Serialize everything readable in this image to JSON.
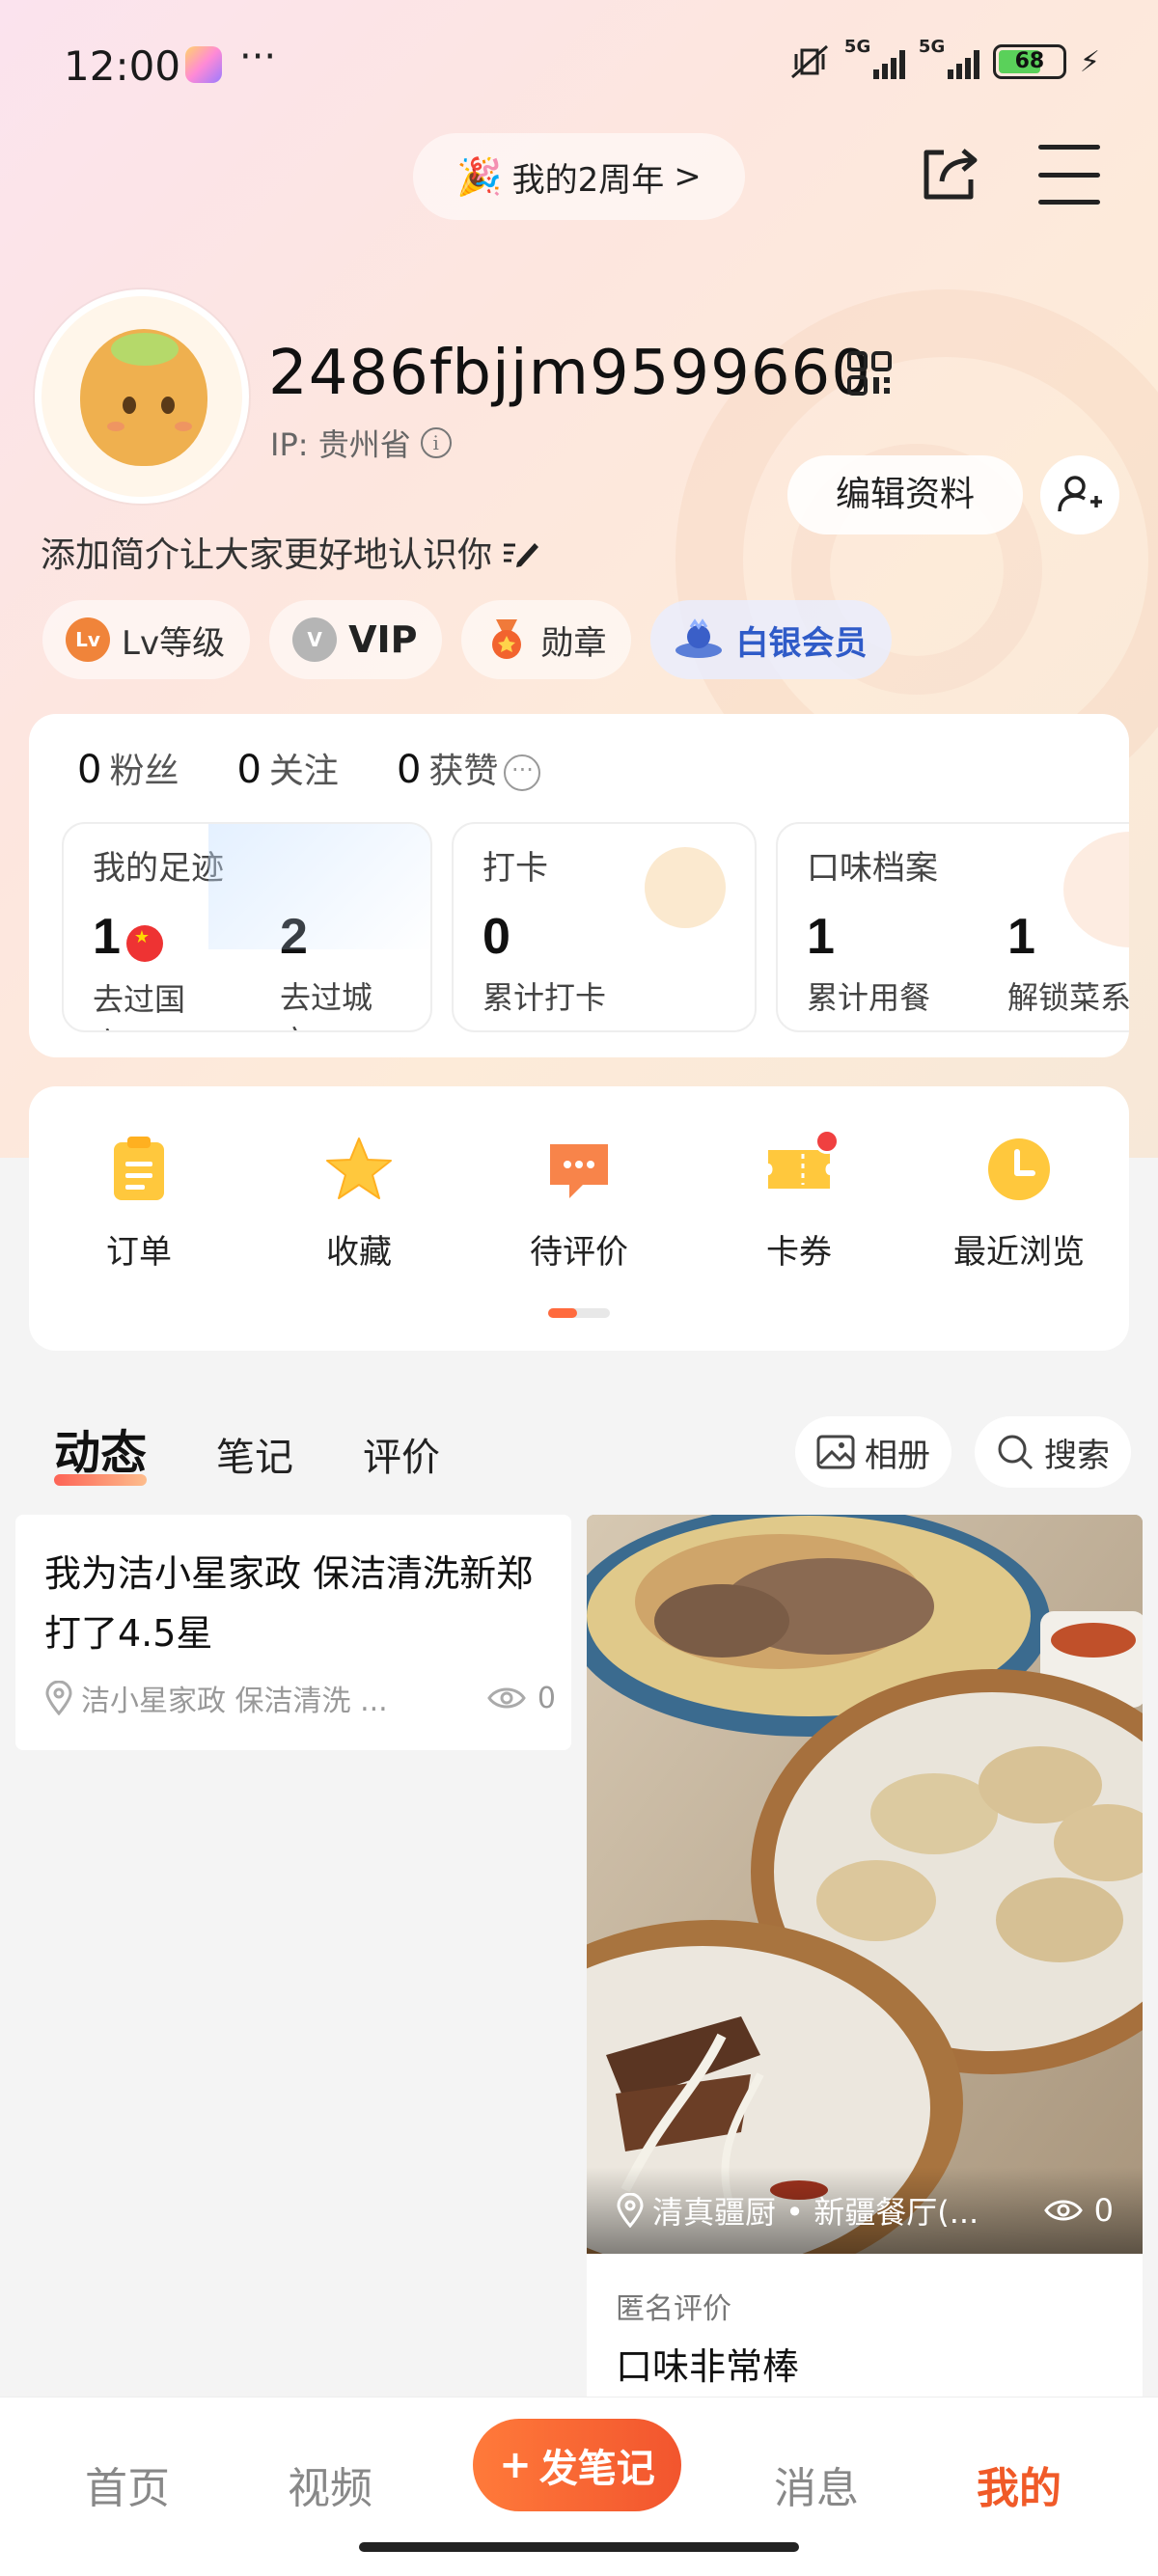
{
  "status_bar": {
    "time": "12:00",
    "more": "···",
    "signal_1": "5G",
    "signal_2": "5G",
    "battery": "68"
  },
  "header": {
    "anniversary": "我的2周年",
    "anniversary_chevron": ">"
  },
  "profile": {
    "username": "2486fbjjm9599660",
    "ip": "IP: 贵州省",
    "edit_button": "编辑资料",
    "bio": "添加简介让大家更好地认识你"
  },
  "badges": [
    {
      "icon": "Lv",
      "label": "Lv等级"
    },
    {
      "icon": "V",
      "label": "VIP"
    },
    {
      "icon": "medal-icon",
      "label": "勋章"
    },
    {
      "icon": "silver-member-icon",
      "label": "白银会员"
    }
  ],
  "stats": {
    "fans": {
      "num": "0",
      "label": "粉丝"
    },
    "following": {
      "num": "0",
      "label": "关注"
    },
    "likes": {
      "num": "0",
      "label": "获赞"
    }
  },
  "mini_cards": {
    "footprint": {
      "title": "我的足迹",
      "countries": "1",
      "countries_label": "去过国家",
      "cities": "2",
      "cities_label": "去过城市"
    },
    "checkin": {
      "title": "打卡",
      "total": "0",
      "total_label": "累计打卡"
    },
    "taste": {
      "title": "口味档案",
      "meals": "1",
      "meals_label": "累计用餐",
      "dishes": "1",
      "dishes_label": "解锁菜系"
    }
  },
  "shortcuts": [
    {
      "label": "订单",
      "icon": "clipboard-icon"
    },
    {
      "label": "收藏",
      "icon": "star-icon"
    },
    {
      "label": "待评价",
      "icon": "comment-icon"
    },
    {
      "label": "卡券",
      "icon": "ticket-icon"
    },
    {
      "label": "最近浏览",
      "icon": "clock-icon"
    }
  ],
  "tabs": [
    "动态",
    "笔记",
    "评价"
  ],
  "tools": {
    "album": "相册",
    "search": "搜索"
  },
  "feed": {
    "post1": {
      "title": "我为洁小星家政 保洁清洗新郑打了4.5星",
      "location": "洁小星家政 保洁清洗 ...",
      "views": "0"
    },
    "post2": {
      "location": "清真疆厨 • 新疆餐厅(...",
      "views": "0",
      "anon": "匿名评价",
      "text": "口味非常棒"
    }
  },
  "bottom_nav": {
    "home": "首页",
    "video": "视频",
    "post": "发笔记",
    "messages": "消息",
    "me": "我的"
  },
  "colors": {
    "accent": "#f05a28",
    "silver_member": "#2f5bc8"
  }
}
